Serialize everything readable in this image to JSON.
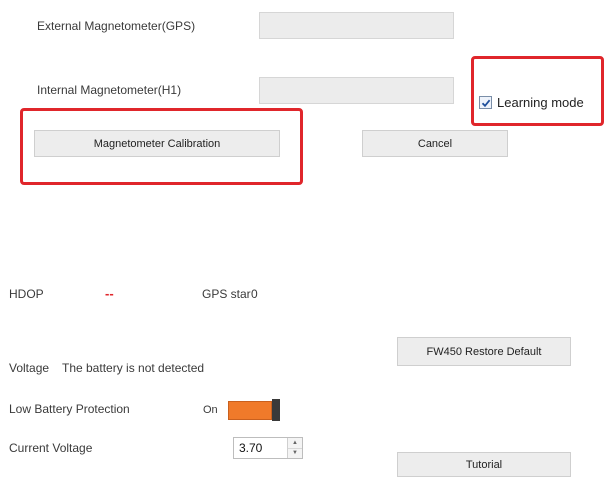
{
  "magnetometer": {
    "external_label": "External Magnetometer(GPS)",
    "internal_label": "Internal Magnetometer(H1)",
    "learning_mode_label": "Learning mode",
    "learning_mode_checked": true,
    "calibration_button": "Magnetometer Calibration",
    "cancel_button": "Cancel"
  },
  "status": {
    "hdop_label": "HDOP",
    "hdop_value": "--",
    "hdop_value_color": "#e0262b",
    "gps_star_label": "GPS star",
    "gps_star_value": "0",
    "voltage_label": "Voltage",
    "voltage_value": "The battery is not detected"
  },
  "battery": {
    "low_protection_label": "Low Battery Protection",
    "toggle_label": "On",
    "toggle_color": "#f07a2a",
    "current_voltage_label": "Current Voltage",
    "current_voltage_value": "3.70"
  },
  "buttons": {
    "restore_default": "FW450 Restore Default",
    "tutorial": "Tutorial"
  },
  "highlight_color": "#e0262b"
}
